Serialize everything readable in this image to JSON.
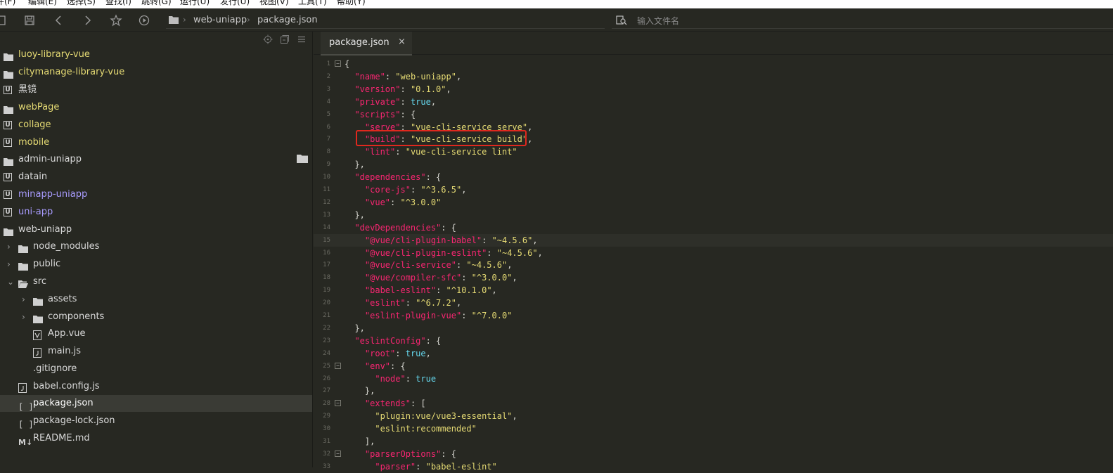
{
  "menu": [
    "件(F)",
    "编辑(E)",
    "选择(S)",
    "查找(I)",
    "跳转(G)",
    "运行(U)",
    "发行(U)",
    "视图(V)",
    "工具(T)",
    "帮助(Y)"
  ],
  "toolbar": {
    "breadcrumb": [
      "web-uniapp",
      "package.json"
    ],
    "search_placeholder": "输入文件名"
  },
  "sidebar": {
    "items": [
      {
        "label": "luoy-library-vue",
        "icon": "folder-icon",
        "color": "#e6db74"
      },
      {
        "label": "citymanage-library-vue",
        "icon": "folder-icon",
        "color": "#e6db74"
      },
      {
        "label": "黑镜",
        "icon": "uniapp-project-icon",
        "color": "#d8d8d8"
      },
      {
        "label": "webPage",
        "icon": "folder-icon",
        "color": "#e6db74"
      },
      {
        "label": "collage",
        "icon": "uniapp-project-icon",
        "color": "#e6db74"
      },
      {
        "label": "mobile",
        "icon": "uniapp-project-icon",
        "color": "#e6db74"
      },
      {
        "label": "admin-uniapp",
        "icon": "folder-icon",
        "color": "#d8d8d8"
      },
      {
        "label": "datain",
        "icon": "uniapp-project-icon",
        "color": "#d8d8d8"
      },
      {
        "label": "minapp-uniapp",
        "icon": "uniapp-project-icon",
        "color": "#a99cff"
      },
      {
        "label": "uni-app",
        "icon": "uniapp-project-icon",
        "color": "#a99cff"
      },
      {
        "label": "web-uniapp",
        "icon": "folder-icon",
        "color": "#d8d8d8"
      },
      {
        "label": "node_modules",
        "icon": "folder-icon",
        "color": "#d8d8d8"
      },
      {
        "label": "public",
        "icon": "folder-icon",
        "color": "#d8d8d8"
      },
      {
        "label": "src",
        "icon": "folder-open-icon",
        "color": "#d8d8d8"
      },
      {
        "label": "assets",
        "icon": "folder-icon",
        "color": "#d8d8d8"
      },
      {
        "label": "components",
        "icon": "folder-icon",
        "color": "#d8d8d8"
      },
      {
        "label": "App.vue",
        "icon": "vue-file-icon",
        "color": "#d8d8d8"
      },
      {
        "label": "main.js",
        "icon": "js-file-icon",
        "color": "#d8d8d8"
      },
      {
        "label": ".gitignore",
        "icon": "file-icon",
        "color": "#d8d8d8"
      },
      {
        "label": "babel.config.js",
        "icon": "js-file-icon",
        "color": "#d8d8d8"
      },
      {
        "label": "package.json",
        "icon": "json-file-icon",
        "color": "#ffffff"
      },
      {
        "label": "package-lock.json",
        "icon": "json-file-icon",
        "color": "#d8d8d8"
      },
      {
        "label": "README.md",
        "icon": "markdown-file-icon",
        "color": "#d8d8d8"
      }
    ]
  },
  "editor": {
    "tab_label": "package.json",
    "tab_close": "×",
    "lines": [
      {
        "n": "1",
        "t": "{"
      },
      {
        "n": "2",
        "t": "  \"name\": \"web-uniapp\","
      },
      {
        "n": "3",
        "t": "  \"version\": \"0.1.0\","
      },
      {
        "n": "4",
        "t": "  \"private\": true,"
      },
      {
        "n": "5",
        "t": "  \"scripts\": {"
      },
      {
        "n": "6",
        "t": "    \"serve\": \"vue-cli-service serve\","
      },
      {
        "n": "7",
        "t": "    \"build\": \"vue-cli-service build\","
      },
      {
        "n": "8",
        "t": "    \"lint\": \"vue-cli-service lint\""
      },
      {
        "n": "9",
        "t": "  },"
      },
      {
        "n": "10",
        "t": "  \"dependencies\": {"
      },
      {
        "n": "11",
        "t": "    \"core-js\": \"^3.6.5\","
      },
      {
        "n": "12",
        "t": "    \"vue\": \"^3.0.0\""
      },
      {
        "n": "13",
        "t": "  },"
      },
      {
        "n": "14",
        "t": "  \"devDependencies\": {"
      },
      {
        "n": "15",
        "t": "    \"@vue/cli-plugin-babel\": \"~4.5.6\","
      },
      {
        "n": "16",
        "t": "    \"@vue/cli-plugin-eslint\": \"~4.5.6\","
      },
      {
        "n": "17",
        "t": "    \"@vue/cli-service\": \"~4.5.6\","
      },
      {
        "n": "18",
        "t": "    \"@vue/compiler-sfc\": \"^3.0.0\","
      },
      {
        "n": "19",
        "t": "    \"babel-eslint\": \"^10.1.0\","
      },
      {
        "n": "20",
        "t": "    \"eslint\": \"^6.7.2\","
      },
      {
        "n": "21",
        "t": "    \"eslint-plugin-vue\": \"^7.0.0\""
      },
      {
        "n": "22",
        "t": "  },"
      },
      {
        "n": "23",
        "t": "  \"eslintConfig\": {"
      },
      {
        "n": "24",
        "t": "    \"root\": true,"
      },
      {
        "n": "25",
        "t": "    \"env\": {"
      },
      {
        "n": "26",
        "t": "      \"node\": true"
      },
      {
        "n": "27",
        "t": "    },"
      },
      {
        "n": "28",
        "t": "    \"extends\": ["
      },
      {
        "n": "29",
        "t": "      \"plugin:vue/vue3-essential\","
      },
      {
        "n": "30",
        "t": "      \"eslint:recommended\""
      },
      {
        "n": "31",
        "t": "    ],"
      },
      {
        "n": "32",
        "t": "    \"parserOptions\": {"
      },
      {
        "n": "33",
        "t": "      \"parser\": \"babel-eslint\""
      }
    ]
  },
  "colors": {
    "key": "#f92672",
    "string": "#e6db74",
    "keyword": "#66d9ef",
    "highlight_box": "#e0281e"
  }
}
